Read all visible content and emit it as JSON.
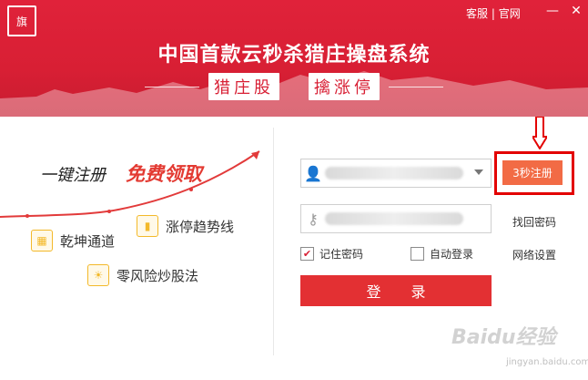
{
  "header": {
    "logo_text": "旗",
    "links": {
      "service": "客服",
      "separator": "|",
      "official_site": "官网"
    },
    "window_controls": {
      "minimize": "—",
      "close": "✕"
    },
    "headline": "中国首款云秒杀猎庄操盘系统",
    "chips": [
      "猎庄股",
      "擒涨停"
    ]
  },
  "left": {
    "slogan_plain": "一键注册",
    "slogan_highlight": "免费领取",
    "features": [
      {
        "icon": "calendar-icon",
        "label": "乾坤通道"
      },
      {
        "icon": "bar-chart-icon",
        "label": "涨停趋势线"
      },
      {
        "icon": "sun-icon",
        "label": "零风险炒股法"
      }
    ]
  },
  "login": {
    "username_value": "",
    "password_value": "",
    "register_button": "3秒注册",
    "find_password": "找回密码",
    "remember_password": "记住密码",
    "remember_checked": true,
    "auto_login": "自动登录",
    "auto_login_checked": false,
    "network_settings": "网络设置",
    "login_button": "登 录"
  },
  "watermark": {
    "text": "Baidu经验",
    "sub": "jingyan.baidu.com"
  },
  "colors": {
    "brand_red": "#d81f34",
    "button_red": "#e33033",
    "register_orange": "#f26b45",
    "highlight_box": "#e30000"
  }
}
